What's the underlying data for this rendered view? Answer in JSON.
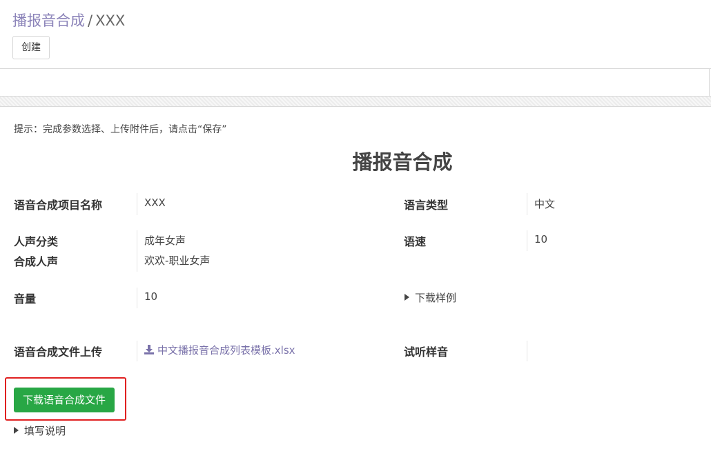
{
  "breadcrumb": {
    "parent": "播报音合成",
    "separator": "/",
    "current": "XXX"
  },
  "toolbar": {
    "create_label": "创建"
  },
  "hint": "提示：完成参数选择、上传附件后，请点击“保存”",
  "form": {
    "title": "播报音合成",
    "project_name_label": "语音合成项目名称",
    "project_name_value": "XXX",
    "language_label": "语言类型",
    "language_value": "中文",
    "voice_category_label": "人声分类",
    "voice_category_value": "成年女声",
    "synth_voice_label": "合成人声",
    "synth_voice_value": "欢欢-职业女声",
    "speed_label": "语速",
    "speed_value": "10",
    "volume_label": "音量",
    "volume_value": "10",
    "download_sample_label": "下载样例",
    "upload_label": "语音合成文件上传",
    "upload_file_name": "中文播报音合成列表模板.xlsx",
    "preview_label": "试听样音",
    "download_button_label": "下载语音合成文件",
    "instructions_label": "填写说明"
  },
  "colors": {
    "link": "#7a72aa",
    "primary_button": "#28a745",
    "highlight_box": "#e02020"
  },
  "icons": {
    "caret": "caret-right-icon",
    "download": "download-icon"
  }
}
